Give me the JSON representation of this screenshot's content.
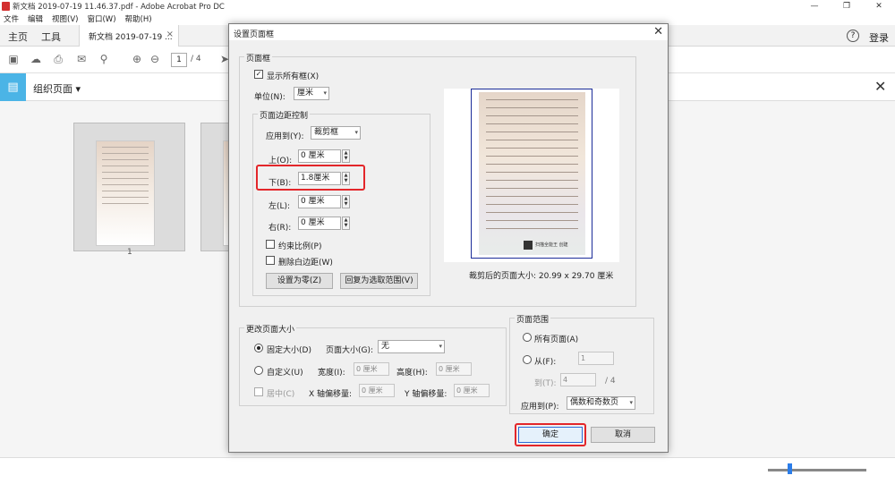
{
  "window": {
    "title": "新文档 2019-07-19 11.46.37.pdf - Adobe Acrobat Pro DC",
    "menu": [
      "文件",
      "编辑",
      "视图(V)",
      "窗口(W)",
      "帮助(H)"
    ],
    "controls": [
      "—",
      "❐",
      "✕"
    ]
  },
  "tabs": {
    "home": "主页",
    "tools": "工具",
    "document": "新文档 2019-07-19 ...",
    "close": "×"
  },
  "header": {
    "help": "?",
    "login": "登录"
  },
  "toolbar": {
    "page_current": "1",
    "page_total": "/ 4"
  },
  "organize": {
    "label": "组织页面 ▾",
    "close": "✕"
  },
  "thumbnails": [
    {
      "page_label": "1"
    }
  ],
  "dialog": {
    "title": "设置页面框",
    "page_boxes": {
      "legend": "页面框",
      "show_all_label": "显示所有框(X)",
      "show_all_checked": true,
      "unit_label": "单位(N):",
      "unit_value": "厘米"
    },
    "margins": {
      "legend": "页面边距控制",
      "apply_to_label": "应用到(Y):",
      "apply_to_value": "裁剪框",
      "top_label": "上(O):",
      "top_value": "0 厘米",
      "bottom_label": "下(B):",
      "bottom_value": "1.8厘米",
      "left_label": "左(L):",
      "left_value": "0 厘米",
      "right_label": "右(R):",
      "right_value": "0 厘米",
      "constrain_label": "约束比例(P)",
      "remove_white_label": "删除白边距(W)",
      "set_zero_button": "设置为零(Z)",
      "revert_button": "回复为选取范围(V)"
    },
    "preview": {
      "size_text": "裁剪后的页面大小: 20.99 x 29.70 厘米",
      "qr_caption": "扫描全能王 创建"
    },
    "change_size": {
      "legend": "更改页面大小",
      "fixed_label": "固定大小(D)",
      "fixed_selected": true,
      "page_size_label": "页面大小(G):",
      "page_size_value": "无",
      "custom_label": "自定义(U)",
      "width_label": "宽度(I):",
      "width_value": "0 厘米",
      "height_label": "高度(H):",
      "height_value": "0 厘米",
      "center_label": "居中(C)",
      "x_offset_label": "X 轴偏移量:",
      "x_offset_value": "0 厘米",
      "y_offset_label": "Y 轴偏移量:",
      "y_offset_value": "0 厘米"
    },
    "page_range": {
      "legend": "页面范围",
      "all_label": "所有页面(A)",
      "from_label": "从(F):",
      "from_value": "1",
      "to_label": "到(T):",
      "to_value": "4",
      "to_total": "/ 4",
      "apply_to_label": "应用到(P):",
      "apply_to_value": "偶数和奇数页"
    },
    "ok_button": "确定",
    "cancel_button": "取消"
  },
  "colors": {
    "accent": "#4bb4e6",
    "highlight": "#e3262a"
  }
}
